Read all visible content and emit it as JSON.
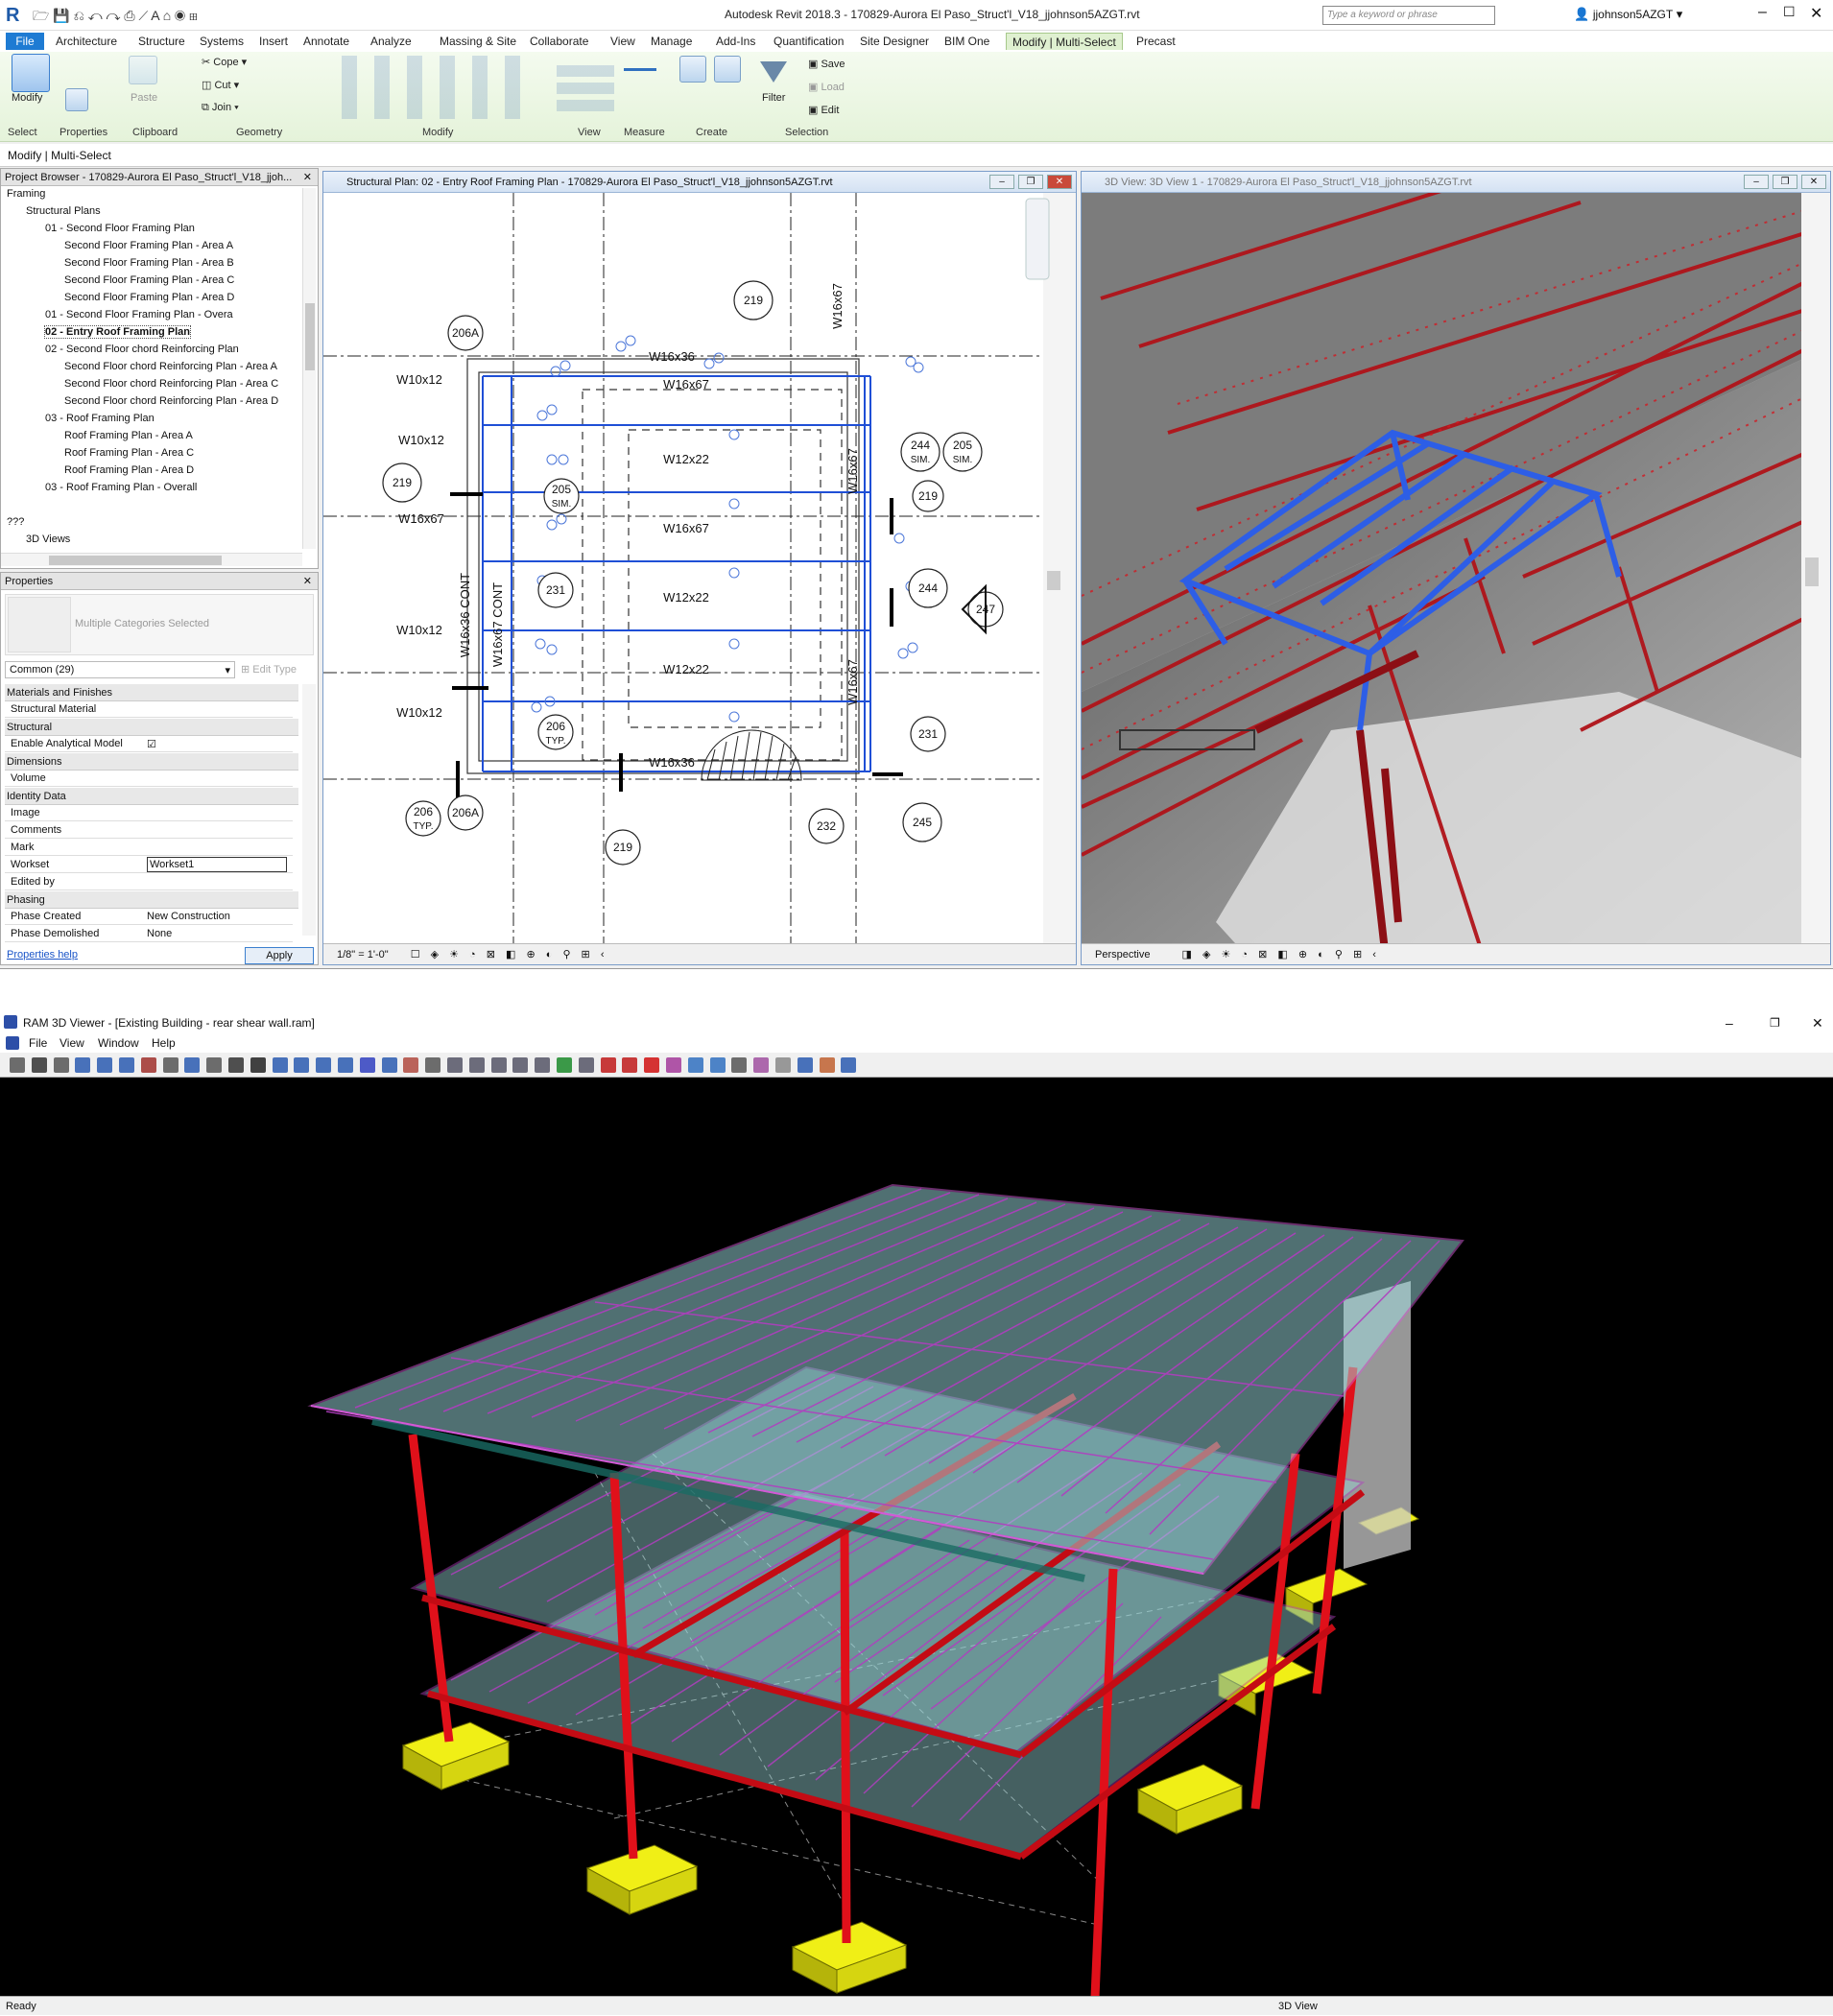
{
  "revit": {
    "app_title": "Autodesk Revit 2018.3 -   170829-Aurora El Paso_Struct'l_V18_jjohnson5AZGT.rvt",
    "search_placeholder": "Type a keyword or phrase",
    "user": "jjohnson5AZGT",
    "tabs": [
      "File",
      "Architecture",
      "Structure",
      "Systems",
      "Insert",
      "Annotate",
      "Analyze",
      "Massing & Site",
      "Collaborate",
      "View",
      "Manage",
      "Add-Ins",
      "Quantification",
      "Site Designer",
      "BIM One",
      "Modify | Multi-Select",
      "Precast"
    ],
    "ribbon": {
      "modify": "Modify",
      "select": "Select",
      "properties": "Properties",
      "paste": "Paste",
      "clipboard": "Clipboard",
      "cope": "Cope",
      "cut": "Cut",
      "join": "Join",
      "geometry": "Geometry",
      "modify_group": "Modify",
      "view": "View",
      "measure": "Measure",
      "create": "Create",
      "filter": "Filter",
      "save": "Save",
      "load": "Load",
      "edit": "Edit",
      "selection": "Selection"
    },
    "options_bar": "Modify | Multi-Select",
    "browser": {
      "title": "Project Browser - 170829-Aurora El Paso_Struct'l_V18_jjoh...",
      "items": [
        {
          "label": "Framing",
          "indent": 0
        },
        {
          "label": "Structural Plans",
          "indent": 1
        },
        {
          "label": "01 - Second Floor Framing Plan",
          "indent": 2
        },
        {
          "label": "Second Floor Framing Plan - Area A",
          "indent": 3
        },
        {
          "label": "Second Floor Framing Plan - Area B",
          "indent": 3
        },
        {
          "label": "Second Floor Framing Plan - Area C",
          "indent": 3
        },
        {
          "label": "Second Floor Framing Plan - Area D",
          "indent": 3
        },
        {
          "label": "01 - Second Floor Framing Plan - Overa",
          "indent": 2
        },
        {
          "label": "02 - Entry Roof Framing Plan",
          "indent": 2,
          "bold": true
        },
        {
          "label": "02 - Second Floor chord Reinforcing Plan",
          "indent": 2
        },
        {
          "label": "Second Floor chord Reinforcing Plan - Area A",
          "indent": 3
        },
        {
          "label": "Second Floor chord Reinforcing Plan - Area C",
          "indent": 3
        },
        {
          "label": "Second Floor chord Reinforcing Plan - Area D",
          "indent": 3
        },
        {
          "label": "03 - Roof Framing Plan",
          "indent": 2
        },
        {
          "label": "Roof Framing Plan - Area A",
          "indent": 3
        },
        {
          "label": "Roof Framing Plan - Area C",
          "indent": 3
        },
        {
          "label": "Roof Framing Plan - Area D",
          "indent": 3
        },
        {
          "label": "03 - Roof Framing Plan - Overall",
          "indent": 2
        },
        {
          "label": "",
          "indent": 0
        },
        {
          "label": "???",
          "indent": 0
        },
        {
          "label": "3D Views",
          "indent": 1
        }
      ]
    },
    "properties": {
      "title": "Properties",
      "type": "Multiple Categories Selected",
      "filter": "Common (29)",
      "edit_type": "Edit Type",
      "rows": [
        {
          "section": "Materials and Finishes"
        },
        {
          "k": "Structural Material",
          "v": ""
        },
        {
          "section": "Structural"
        },
        {
          "k": "Enable Analytical Model",
          "v": "☑"
        },
        {
          "section": "Dimensions"
        },
        {
          "k": "Volume",
          "v": ""
        },
        {
          "section": "Identity Data"
        },
        {
          "k": "Image",
          "v": ""
        },
        {
          "k": "Comments",
          "v": ""
        },
        {
          "k": "Mark",
          "v": ""
        },
        {
          "k": "Workset",
          "v": "Workset1"
        },
        {
          "k": "Edited by",
          "v": ""
        },
        {
          "section": "Phasing"
        },
        {
          "k": "Phase Created",
          "v": "New Construction"
        },
        {
          "k": "Phase Demolished",
          "v": "None"
        }
      ],
      "help": "Properties help",
      "apply": "Apply"
    },
    "plan_view": {
      "title": "Structural Plan: 02 - Entry Roof Framing Plan - 170829-Aurora El Paso_Struct'l_V18_jjohnson5AZGT.rvt",
      "scale": "1/8\" = 1'-0\"",
      "beams": [
        "W16x36",
        "W16x67",
        "W12x22",
        "W16x67",
        "W12x22",
        "W12x22",
        "W16x36"
      ],
      "left_beams": [
        "W10x12",
        "W10x12",
        "W16x67",
        "W10x12",
        "W10x12"
      ],
      "vertical": [
        "W16x36 CONT",
        "W16x67 CONT",
        "W16x67",
        "W16x67",
        "W16x67"
      ],
      "tags": [
        "219",
        "206A",
        "219",
        "205",
        "244",
        "205",
        "231",
        "219",
        "244",
        "247",
        "206",
        "206A",
        "206",
        "231",
        "232",
        "245",
        "219"
      ],
      "sim": "SIM.",
      "typ": "TYP."
    },
    "view3d": {
      "title": "3D View: 3D View 1 - 170829-Aurora El Paso_Struct'l_V18_jjohnson5AZGT.rvt",
      "status": "Perspective"
    }
  },
  "ram": {
    "title": "RAM 3D Viewer - [Existing Building - rear shear wall.ram]",
    "menu": [
      "File",
      "View",
      "Window",
      "Help"
    ],
    "status_left": "Ready",
    "status_right": "3D View"
  },
  "colors": {
    "revit_accent": "#1e7bd3",
    "selection_blue": "#2a5ee8",
    "steel_red": "#c8131b",
    "footing_yellow": "#f0ef16",
    "ram_bg": "#000000"
  }
}
